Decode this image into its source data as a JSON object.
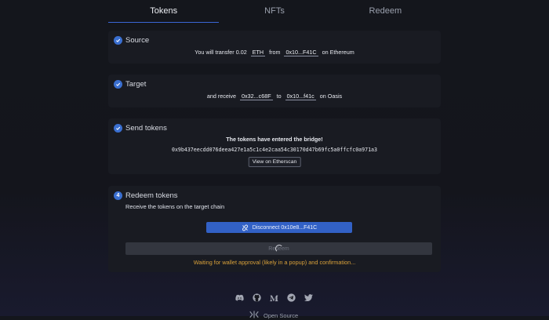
{
  "tabs": [
    {
      "label": "Tokens",
      "active": true
    },
    {
      "label": "NFTs",
      "active": false
    },
    {
      "label": "Redeem",
      "active": false
    }
  ],
  "source": {
    "title": "Source",
    "prefix": "You will transfer",
    "amount": "0.02",
    "token": "ETH",
    "from_word": "from",
    "address": "0x10...F41C",
    "chain_text": "on Ethereum"
  },
  "target": {
    "title": "Target",
    "prefix": "and receive",
    "token_address": "0x32...c68F",
    "to_word": "to",
    "address": "0x10...f41c",
    "chain_text": "on Oasis"
  },
  "send": {
    "title": "Send tokens",
    "message": "The tokens have entered the bridge!",
    "tx_hash": "0x9b437eecdd076deea427e1a5c1c4e2caa54c30170d47b69fc5a0ffcfc0a971a3",
    "view_label": "View on Etherscan"
  },
  "redeem": {
    "step_number": "4",
    "title": "Redeem tokens",
    "subtitle": "Receive the tokens on the target chain",
    "disconnect_label": "Disconnect 0x10e8...F41C",
    "redeem_label": "Redeem",
    "waiting_text": "Waiting for wallet approval (likely in a popup) and confirmation..."
  },
  "footer": {
    "icons": [
      "discord-icon",
      "github-icon",
      "medium-icon",
      "telegram-icon",
      "twitter-icon"
    ],
    "label": "Open Source"
  },
  "colors": {
    "accent": "#3a6fd0",
    "warning": "#d9a13a",
    "card": "#191b22"
  }
}
